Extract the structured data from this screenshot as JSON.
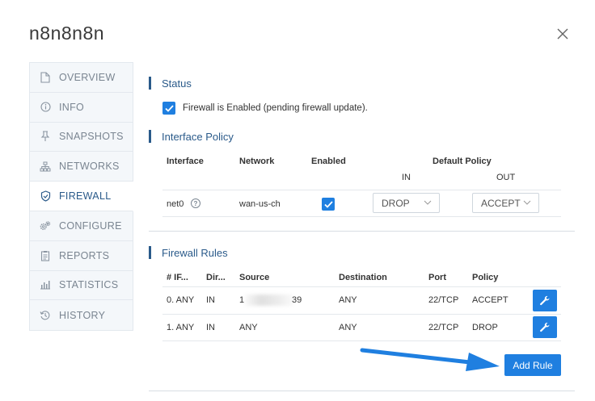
{
  "dialog": {
    "title": "n8n8n8n"
  },
  "sidebar": {
    "items": [
      {
        "label": "OVERVIEW",
        "icon": "document-icon"
      },
      {
        "label": "INFO",
        "icon": "info-icon"
      },
      {
        "label": "SNAPSHOTS",
        "icon": "pin-icon"
      },
      {
        "label": "NETWORKS",
        "icon": "network-icon"
      },
      {
        "label": "FIREWALL",
        "icon": "shield-icon",
        "active": true
      },
      {
        "label": "CONFIGURE",
        "icon": "gears-icon"
      },
      {
        "label": "REPORTS",
        "icon": "clipboard-icon"
      },
      {
        "label": "STATISTICS",
        "icon": "bar-chart-icon"
      },
      {
        "label": "HISTORY",
        "icon": "history-icon"
      }
    ]
  },
  "status": {
    "heading": "Status",
    "firewall_text": "Firewall is Enabled (pending firewall update).",
    "checked": true
  },
  "interface_policy": {
    "heading": "Interface Policy",
    "headers": {
      "interface": "Interface",
      "network": "Network",
      "enabled": "Enabled",
      "default_policy": "Default Policy",
      "in": "IN",
      "out": "OUT"
    },
    "row": {
      "interface": "net0",
      "help": "?",
      "network": "wan-us-ch",
      "enabled": true,
      "in_value": "DROP",
      "out_value": "ACCEPT"
    }
  },
  "firewall_rules": {
    "heading": "Firewall Rules",
    "headers": [
      "# IF...",
      "Dir...",
      "Source",
      "Destination",
      "Port",
      "Policy"
    ],
    "rows": [
      {
        "if": "0. ANY",
        "dir": "IN",
        "source_start": "1",
        "source_end": "39",
        "destination": "ANY",
        "port": "22/TCP",
        "policy": "ACCEPT"
      },
      {
        "if": "1. ANY",
        "dir": "IN",
        "source": "ANY",
        "destination": "ANY",
        "port": "22/TCP",
        "policy": "DROP"
      }
    ],
    "add_label": "Add Rule"
  },
  "colors": {
    "accent": "#1f7fe0",
    "heading": "#2a5a8a",
    "arrow": "#1f7fe0"
  }
}
